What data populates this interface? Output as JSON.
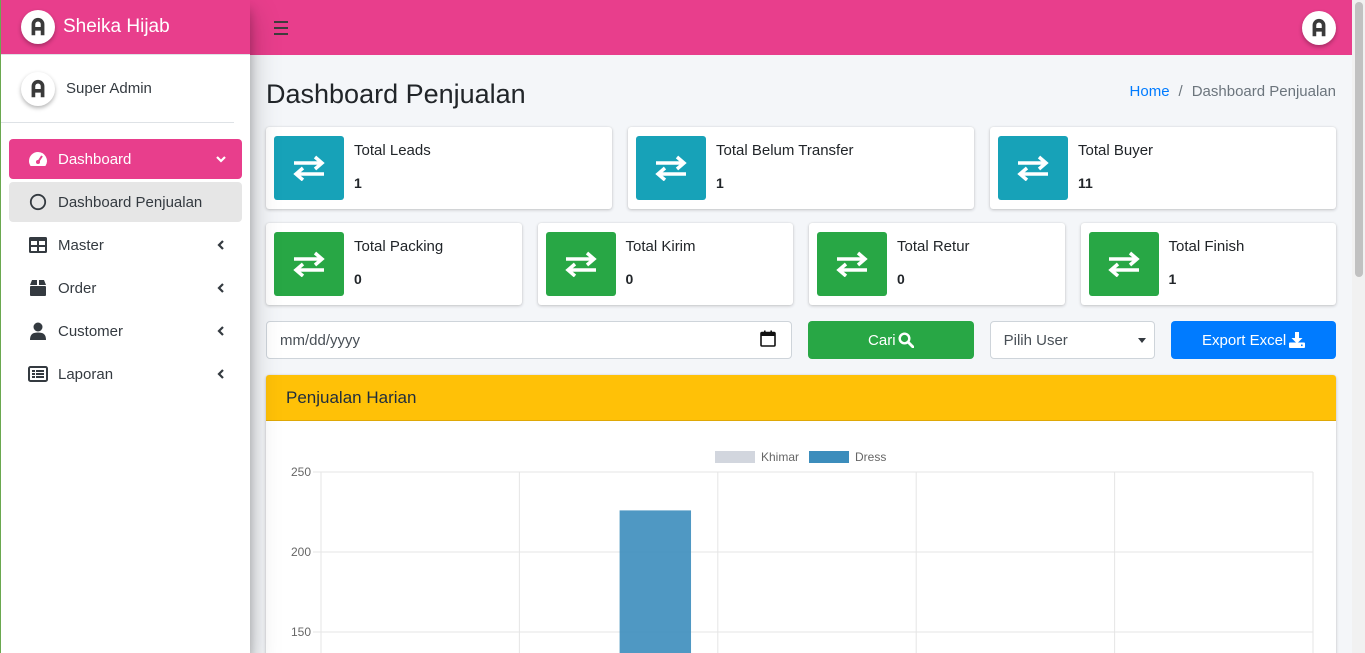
{
  "brand": {
    "name": "Sheika Hijab"
  },
  "user": {
    "name": "Super Admin"
  },
  "sidebar": {
    "items": [
      {
        "label": "Dashboard",
        "icon": "tachometer-icon",
        "chevron": "down"
      },
      {
        "label": "Dashboard Penjualan",
        "icon": "circle-icon"
      },
      {
        "label": "Master",
        "icon": "table-icon",
        "chevron": "left"
      },
      {
        "label": "Order",
        "icon": "box-icon",
        "chevron": "left"
      },
      {
        "label": "Customer",
        "icon": "user-icon",
        "chevron": "left"
      },
      {
        "label": "Laporan",
        "icon": "list-alt-icon",
        "chevron": "left"
      }
    ]
  },
  "page": {
    "title": "Dashboard Penjualan",
    "breadcrumb": {
      "home": "Home",
      "sep": "/",
      "current": "Dashboard Penjualan"
    }
  },
  "stats_row1": [
    {
      "label": "Total Leads",
      "value": "1"
    },
    {
      "label": "Total Belum Transfer",
      "value": "1"
    },
    {
      "label": "Total Buyer",
      "value": "11"
    }
  ],
  "stats_row2": [
    {
      "label": "Total Packing",
      "value": "0"
    },
    {
      "label": "Total Kirim",
      "value": "0"
    },
    {
      "label": "Total Retur",
      "value": "0"
    },
    {
      "label": "Total Finish",
      "value": "1"
    }
  ],
  "filters": {
    "date_placeholder": "mm/dd/yyyy",
    "search_label": "Cari",
    "user_select": "Pilih User",
    "export_label": "Export Excel"
  },
  "colors": {
    "brand": "#e83e8c",
    "teal": "#17a2b8",
    "green": "#28a745",
    "blue": "#007bff",
    "warning": "#ffc107"
  },
  "card": {
    "title": "Penjualan Harian"
  },
  "chart_data": {
    "type": "bar",
    "series": [
      {
        "name": "Khimar",
        "color": "#d2d6de",
        "values": [
          0,
          0,
          0,
          0,
          0
        ]
      },
      {
        "name": "Dress",
        "color": "#3c8dbc",
        "values": [
          0,
          226,
          0,
          0,
          0
        ]
      }
    ],
    "categories_count": 5,
    "yticks": [
      "250",
      "200",
      "150"
    ],
    "ylim_visible": [
      140,
      250
    ],
    "grid": true,
    "legend": "top-center"
  }
}
